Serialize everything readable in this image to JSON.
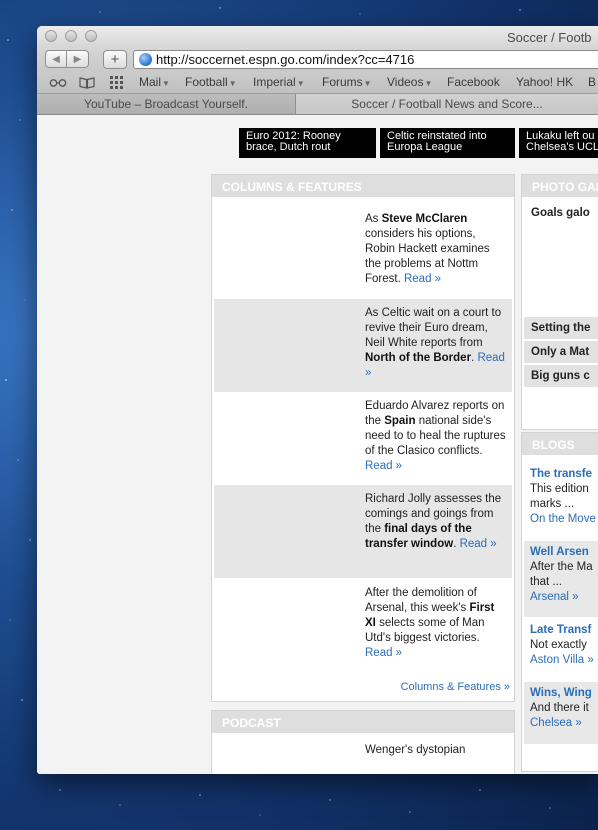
{
  "window": {
    "title": "Soccer / Footb"
  },
  "toolbar": {
    "back_label": "◀",
    "forward_label": "▶",
    "add_label": "+",
    "url": "http://soccernet.espn.go.com/index?cc=4716"
  },
  "bookmarks": {
    "reading_icon": "reading-list-icon",
    "book_icon": "bookmarks-book-icon",
    "grid_icon": "top-sites-grid-icon",
    "items": [
      "Mail",
      "Football",
      "Imperial",
      "Forums",
      "Videos",
      "Facebook",
      "Yahoo! HK",
      "B"
    ]
  },
  "tabs": [
    "YouTube – Broadcast Yourself.",
    "Soccer / Football News and Score..."
  ],
  "headlines": [
    "Euro 2012: Rooney brace, Dutch rout",
    "Celtic reinstated into Europa League",
    "Lukaku left ou Chelsea's UCL"
  ],
  "columns": {
    "heading": "COLUMNS & FEATURES",
    "more_label": "Columns & Features »",
    "items": [
      {
        "pre": "As ",
        "bold": "Steve McClaren",
        "post": " considers his options, Robin Hackett examines the problems at Nottm Forest. ",
        "link": "Read »"
      },
      {
        "pre": "As Celtic wait on a court to revive their Euro dream, Neil White reports from ",
        "bold": "North of the Border",
        "post": ". ",
        "link": "Read »"
      },
      {
        "pre": "Eduardo Alvarez reports on the ",
        "bold": "Spain",
        "post": " national side's need to to heal the ruptures of the Clasico conflicts. ",
        "link": "Read »"
      },
      {
        "pre": "Richard Jolly assesses the comings and goings from the ",
        "bold": "final days of the transfer window",
        "post": ". ",
        "link": "Read »"
      },
      {
        "pre": "After the demolition of Arsenal, this week's ",
        "bold": "First XI",
        "post": " selects some of Man Utd's biggest victories. ",
        "link": "Read »"
      }
    ]
  },
  "podcast": {
    "heading": "PODCAST",
    "text": "Wenger's dystopian"
  },
  "photo": {
    "heading": "PHOTO GAL",
    "first": "Goals galo",
    "items": [
      "Setting the",
      "Only a Mat",
      "Big guns c"
    ]
  },
  "blogs": {
    "heading": "BLOGS",
    "items": [
      {
        "title": "The transfe",
        "line1": "This edition",
        "line2": "marks ...",
        "link": "On the Move"
      },
      {
        "title": "Well Arsen",
        "line1": "After the Ma",
        "line2": "that ...",
        "link": "Arsenal »"
      },
      {
        "title": "Late Transf",
        "line1": "Not exactly",
        "line2": "",
        "link": "Aston Villa »"
      },
      {
        "title": "Wins, Wing",
        "line1": "And there it",
        "line2": "",
        "link": "Chelsea »"
      }
    ]
  }
}
